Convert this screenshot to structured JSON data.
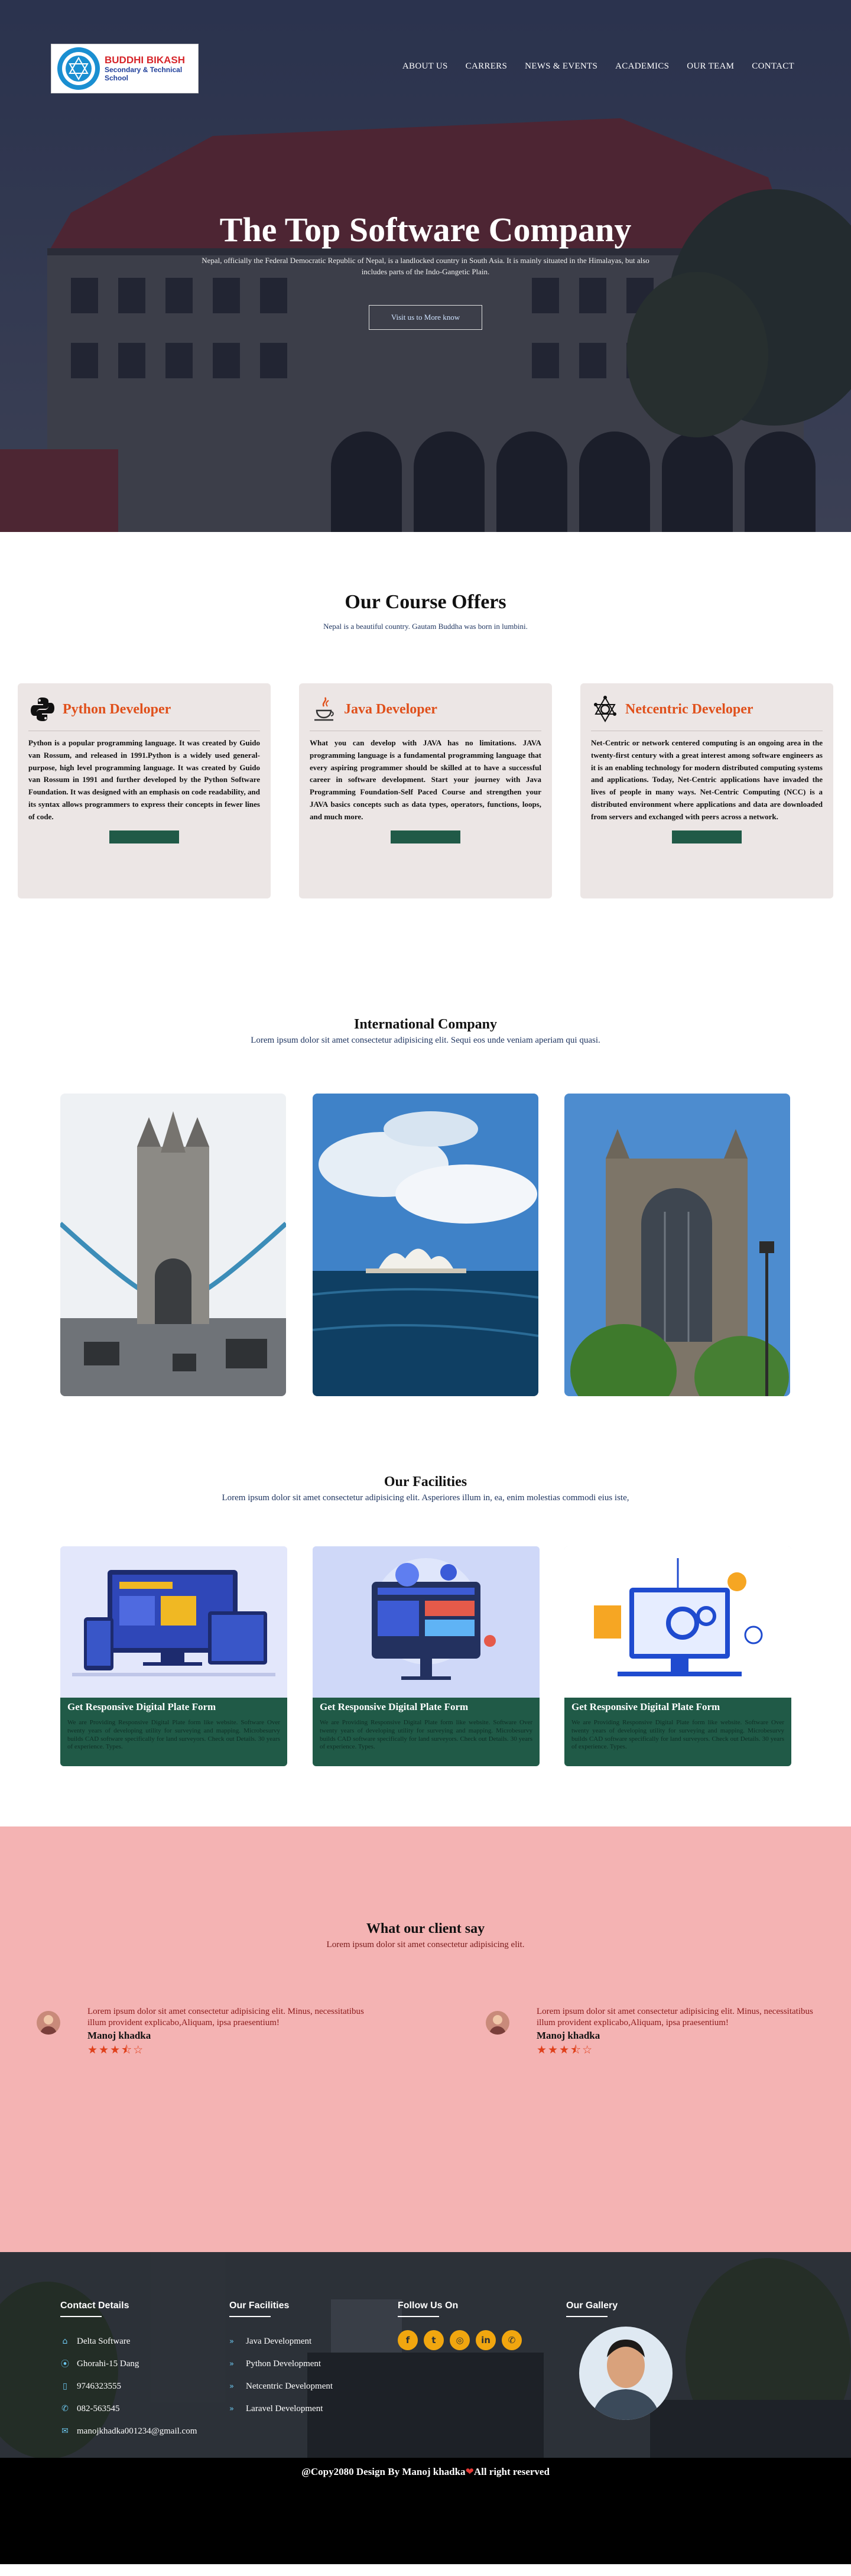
{
  "logo": {
    "line1": "BUDDHI BIKASH",
    "line2": "Secondary & Technical School"
  },
  "nav": [
    "ABOUT US",
    "CARRERS",
    "NEWS & EVENTS",
    "ACADEMICS",
    "OUR TEAM",
    "CONTACT"
  ],
  "hero": {
    "title": "The Top Software Company",
    "description": "Nepal, officially the Federal Democratic Republic of Nepal, is a landlocked country in South Asia. It is mainly situated in the Himalayas, but also includes parts of the Indo-Gangetic Plain.",
    "button": "Visit us to More know"
  },
  "courses": {
    "title": "Our Course Offers",
    "subtitle": "Nepal is a beautiful country. Gautam Buddha was born in lumbini.",
    "cards": [
      {
        "icon": "python-icon",
        "title": "Python Developer",
        "text": "Python is a popular programming language. It was created by Guido van Rossum, and released in 1991.Python is a widely used general-purpose, high level programming language. It was created by Guido van Rossum in 1991 and further developed by the Python Software Foundation. It was designed with an emphasis on code readability, and its syntax allows programmers to express their concepts in fewer lines of code."
      },
      {
        "icon": "java-icon",
        "title": "Java Developer",
        "text": "What you can develop with JAVA has no limitations. JAVA programming language is a fundamental programming language that every aspiring programmer should be skilled at to have a successful career in software development. Start your journey with Java Programming Foundation-Self Paced Course and strengthen your JAVA basics concepts such as data types, operators, functions, loops, and much more."
      },
      {
        "icon": "network-icon",
        "title": "Netcentric Developer",
        "text": "Net-Centric or network centered computing is an ongoing area in the twenty-first century with a great interest among software engineers as it is an enabling technology for modern distributed computing systems and applications. Today, Net-Centric applications have invaded the lives of people in many ways. Net-Centric Computing (NCC) is a distributed environment where applications and data are downloaded from servers and exchanged with peers across a network."
      }
    ]
  },
  "international": {
    "title": "International Company",
    "subtitle": "Lorem ipsum dolor sit amet consectetur adipisicing elit. Sequi eos unde veniam aperiam qui quasi."
  },
  "facilities": {
    "title": "Our Facilities",
    "subtitle": "Lorem ipsum dolor sit amet consectetur adipisicing elit. Asperiores illum in, ea, enim molestias commodi eius iste,",
    "cards": [
      {
        "title": "Get Responsive Digital Plate Form",
        "text": "We are Providing Responsive Digital Plate form like website. Software Over twenty years of developing utility for surveying and mapping. Microbesurvy builds CAD software specifically for land surveyors. Check out Details. 30 years of experience. Types."
      },
      {
        "title": "Get Responsive Digital Plate Form",
        "text": "We are Providing Responsive Digital Plate form like website. Software Over twenty years of developing utility for surveying and mapping. Microbesurvy builds CAD software specifically for land surveyors. Check out Details. 30 years of experience. Types."
      },
      {
        "title": "Get Responsive Digital Plate Form",
        "text": "We are Providing Responsive Digital Plate form like website. Software Over twenty years of developing utility for surveying and mapping. Microbesurvy builds CAD software specifically for land surveyors. Check out Details. 30 years of experience. Types."
      }
    ]
  },
  "clients": {
    "title": "What our client say",
    "subtitle": "Lorem ipsum dolor sit amet consectetur adipisicing elit.",
    "reviews": [
      {
        "text": "Lorem ipsum dolor sit amet consectetur adipisicing elit. Minus, necessitatibus illum provident explicabo,Aliquam, ipsa praesentium!",
        "name": "Manoj khadka",
        "stars": "★★★⯪☆",
        "rating": 3.5
      },
      {
        "text": "Lorem ipsum dolor sit amet consectetur adipisicing elit. Minus, necessitatibus illum provident explicabo,Aliquam, ipsa praesentium!",
        "name": "Manoj khadka",
        "stars": "★★★⯪☆",
        "rating": 3.5
      }
    ]
  },
  "footer": {
    "contact": {
      "title": "Contact Details",
      "items": [
        {
          "icon": "home-icon",
          "text": "Delta Software"
        },
        {
          "icon": "location-pin-icon",
          "text": "Ghorahi-15 Dang"
        },
        {
          "icon": "mobile-icon",
          "text": "9746323555"
        },
        {
          "icon": "phone-icon",
          "text": "082-563545"
        },
        {
          "icon": "mail-icon",
          "text": "manojkhadka001234@gmail.com"
        }
      ]
    },
    "facilities": {
      "title": "Our Facilities",
      "items": [
        "Java Development",
        "Python Development",
        "Netcentric Development",
        "Laravel Development"
      ]
    },
    "follow": {
      "title": "Follow Us On",
      "icons": [
        "facebook-icon",
        "twitter-icon",
        "instagram-icon",
        "linkedin-icon",
        "whatsapp-icon"
      ]
    },
    "gallery": {
      "title": "Our Gallery"
    }
  },
  "copyright": {
    "before": "@Copy2080 Design By Manoj khadka",
    "heart": "❤",
    "after": "All right reserved"
  },
  "colors": {
    "accent_orange": "#e0501b",
    "button_green": "#205a47",
    "clients_bg": "#f4b3b3",
    "footer_bg": "#2c3138",
    "social_yellow": "#f1a60f"
  }
}
